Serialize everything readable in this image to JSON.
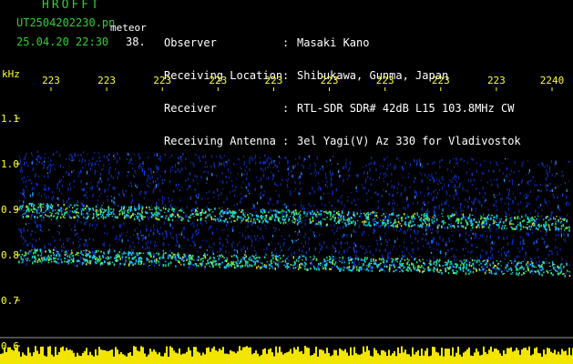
{
  "header": {
    "program": "HROFFT",
    "filename": "UT2504202230.pn",
    "meteor_label": "meteor",
    "datetime": "25.04.20 22:30",
    "count": "38.",
    "info": [
      {
        "label": "Observer",
        "value": "Masaki Kano"
      },
      {
        "label": "Receiving Location",
        "value": "Shibukawa, Gunma, Japan"
      },
      {
        "label": "Receiver",
        "value": "RTL-SDR SDR# 42dB L15 103.8MHz CW"
      },
      {
        "label": "Receiving Antenna",
        "value": "3el Yagi(V) Az 330 for Vladivostok"
      }
    ]
  },
  "axes": {
    "y_unit": "kHz",
    "y_ticks": [
      "1.1",
      "1.0",
      "0.9",
      "0.8",
      "0.7",
      "0.6"
    ],
    "time_ticks": [
      "223",
      "223",
      "223",
      "223",
      "223",
      "223",
      "223",
      "223",
      "223",
      "2240"
    ]
  },
  "spectrogram": {
    "freq_range_khz": [
      0.6,
      1.1
    ],
    "echo_bands_khz": [
      0.9,
      0.8
    ],
    "noise_band_khz": [
      0.78,
      1.03
    ]
  },
  "colors": {
    "text_green": "#2fd02f",
    "text_white": "#ffffff",
    "axis_yellow": "#ffff33",
    "background": "#000000",
    "spectrum_blue": "#0a3cff"
  }
}
